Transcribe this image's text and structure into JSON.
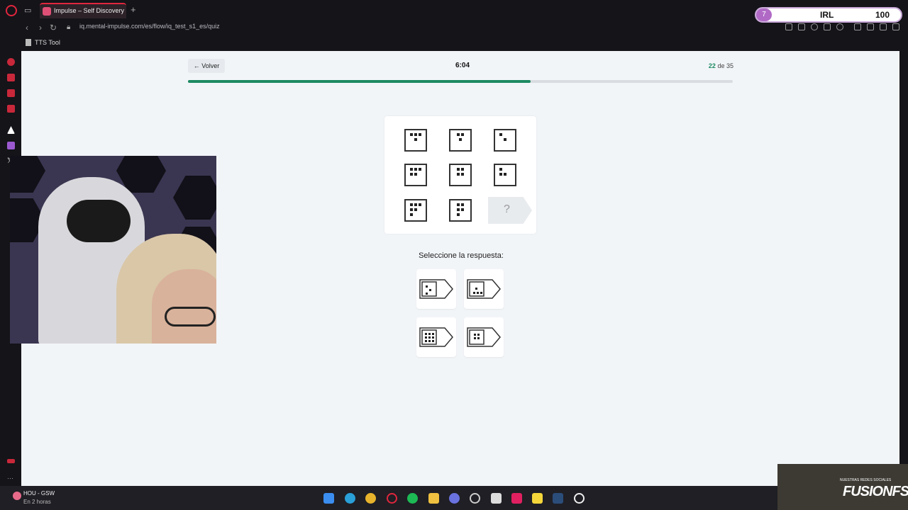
{
  "browser": {
    "tab_title": "Impulse – Self Discovery",
    "new_tab_symbol": "+",
    "url": "iq.mental-impulse.com/es/flow/iq_test_s1_es/quiz",
    "bookmark": "TTS Tool",
    "accent": "#e0263d"
  },
  "overlay": {
    "level": "7",
    "label": "IRL",
    "count": "100"
  },
  "quiz": {
    "back_label": "Volver",
    "timer": "6:04",
    "current": "22",
    "of_word": "de",
    "total": "35",
    "progress_fraction": 0.629,
    "question_mark": "?",
    "select_label": "Seleccione la respuesta:",
    "accent": "#1d8a62"
  },
  "taskbar": {
    "weather_title": "HOU - GSW",
    "weather_sub": "En 2 horas"
  },
  "stream_banner": {
    "small_text": "NUESTRAS REDES SOCIALES",
    "big_text": "FUSIONFSGG"
  }
}
